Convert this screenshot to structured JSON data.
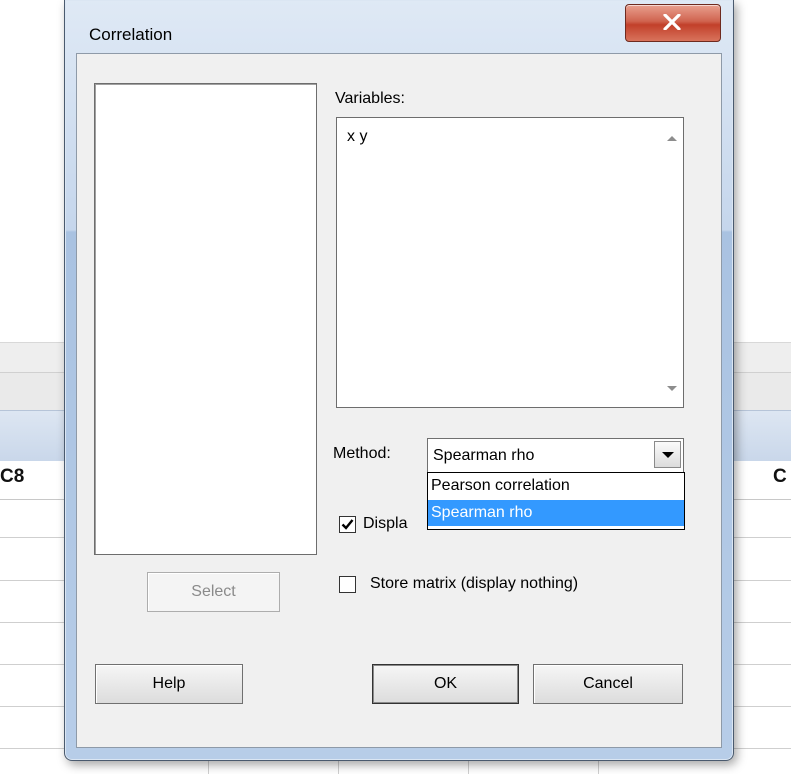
{
  "dialog": {
    "title": "Correlation",
    "variables_label": "Variables:",
    "variables_value": "x y",
    "method_label": "Method:",
    "method_selected": "Spearman rho",
    "method_options": [
      "Pearson correlation",
      "Spearman rho"
    ],
    "display_checkbox_label": "Displa",
    "display_checked": true,
    "store_matrix_label": "Store matrix (display nothing)",
    "store_matrix_checked": false,
    "buttons": {
      "select": "Select",
      "help": "Help",
      "ok": "OK",
      "cancel": "Cancel"
    }
  },
  "background": {
    "left_column_header": "C8",
    "right_column_header": "C"
  },
  "icons": {
    "close": "close-icon",
    "dropdown": "chevron-down-icon",
    "checkmark": "checkmark-icon"
  },
  "colors": {
    "selection": "#3399ff",
    "close_button": "#c2402a",
    "frame": "#b7cde8"
  }
}
